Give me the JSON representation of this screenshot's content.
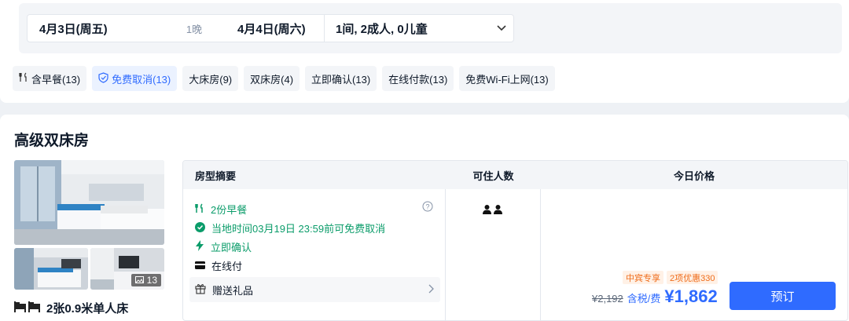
{
  "search": {
    "checkin": "4月3日(周五)",
    "nights": "1晚",
    "checkout": "4月4日(周六)",
    "guests": "1间, 2成人, 0儿童"
  },
  "filters": [
    {
      "label": "含早餐(13)",
      "icon": "fork-knife-icon",
      "active": false
    },
    {
      "label": "免费取消(13)",
      "icon": "shield-check-icon",
      "active": true
    },
    {
      "label": "大床房(9)",
      "active": false
    },
    {
      "label": "双床房(4)",
      "active": false
    },
    {
      "label": "立即确认(13)",
      "active": false
    },
    {
      "label": "在线付款(13)",
      "active": false
    },
    {
      "label": "免费Wi-Fi上网(13)",
      "active": false
    }
  ],
  "room": {
    "title": "高级双床房",
    "photo_count": "13",
    "bed": "2张0.9米单人床"
  },
  "table": {
    "headers": [
      "房型摘要",
      "可住人数",
      "今日价格"
    ],
    "breakfast": "2份早餐",
    "cancel": "当地时间03月19日 23:59前可免费取消",
    "confirm": "立即确认",
    "payment": "在线付",
    "gift": "赠送礼品",
    "badge1": "中宾专享",
    "badge2": "2项优惠330",
    "original_price": "¥2,192",
    "tax_label": "含税/费",
    "price": "¥1,862",
    "book": "预订"
  },
  "colors": {
    "accent": "#2f6bff",
    "green": "#0b9c6a",
    "orange": "#ef6c1a"
  }
}
